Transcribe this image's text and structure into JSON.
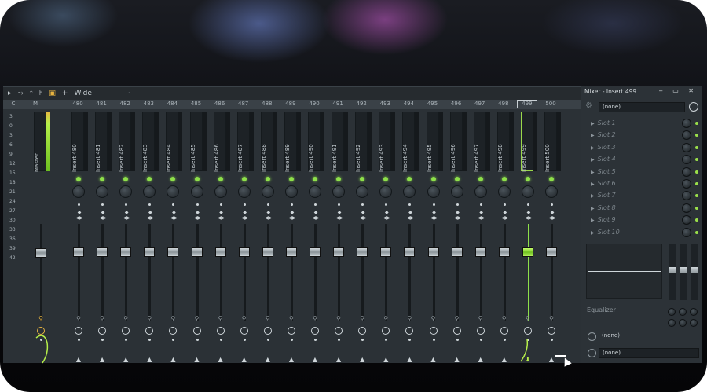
{
  "toolbar": {
    "items": [
      "▸",
      "⤳",
      "⤒",
      "⊧",
      "▣",
      "+"
    ],
    "view_label": "Wide",
    "extra": "·"
  },
  "ruler": {
    "fixed": [
      "C",
      "M"
    ],
    "numbers": [
      "480",
      "481",
      "482",
      "483",
      "484",
      "485",
      "486",
      "487",
      "488",
      "489",
      "490",
      "491",
      "492",
      "493",
      "494",
      "495",
      "496",
      "497",
      "498",
      "499",
      "500"
    ],
    "active": "499"
  },
  "scale": [
    "3",
    "0",
    "3",
    "6",
    "9",
    "12",
    "15",
    "18",
    "21",
    "24",
    "27",
    "30",
    "33",
    "36",
    "39",
    "42"
  ],
  "strips": [
    {
      "name": "Master"
    },
    {
      "name": "Insert 480"
    },
    {
      "name": "Insert 481"
    },
    {
      "name": "Insert 482"
    },
    {
      "name": "Insert 483"
    },
    {
      "name": "Insert 484"
    },
    {
      "name": "Insert 485"
    },
    {
      "name": "Insert 486"
    },
    {
      "name": "Insert 487"
    },
    {
      "name": "Insert 488"
    },
    {
      "name": "Insert 489"
    },
    {
      "name": "Insert 490"
    },
    {
      "name": "Insert 491"
    },
    {
      "name": "Insert 492"
    },
    {
      "name": "Insert 493"
    },
    {
      "name": "Insert 494"
    },
    {
      "name": "Insert 495"
    },
    {
      "name": "Insert 496"
    },
    {
      "name": "Insert 497"
    },
    {
      "name": "Insert 498"
    },
    {
      "name": "Insert 499"
    },
    {
      "name": "Insert 500"
    }
  ],
  "selected_strip": "Insert 499",
  "panel": {
    "title": "Mixer - Insert 499",
    "controls": "‒ ▭ ✕",
    "preset": "(none)",
    "slots": [
      "Slot 1",
      "Slot 2",
      "Slot 3",
      "Slot 4",
      "Slot 5",
      "Slot 6",
      "Slot 7",
      "Slot 8",
      "Slot 9",
      "Slot 10"
    ],
    "eq_label": "Equalizer",
    "input": "(none)",
    "output": "(none)"
  },
  "colors": {
    "accent": "#8ee04a",
    "panel_bg": "#2c3237",
    "mixer_bg": "#2b3136"
  }
}
